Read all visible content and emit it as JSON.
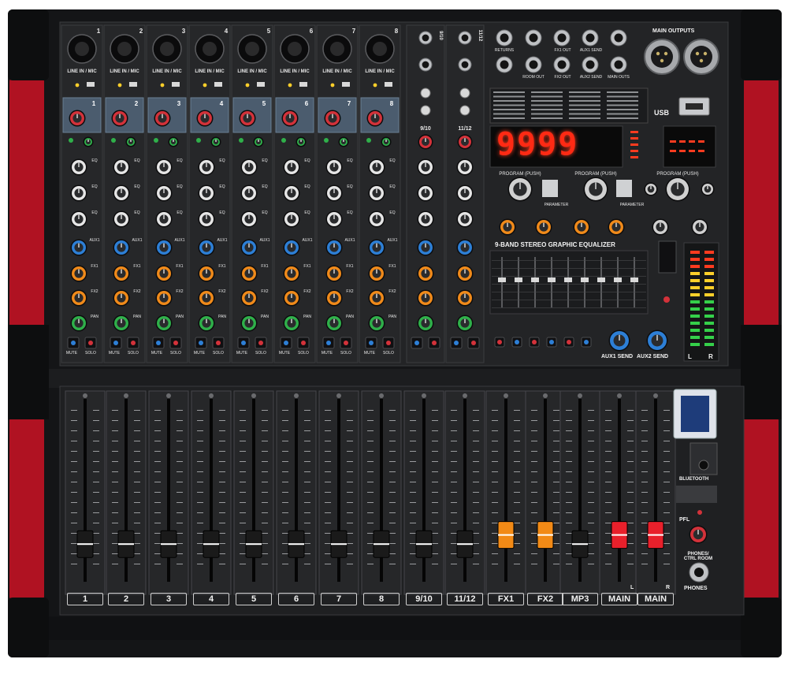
{
  "top_panel": {
    "input_label": "LINE IN / MIC",
    "channel_numbers": [
      "1",
      "2",
      "3",
      "4",
      "5",
      "6",
      "7",
      "8"
    ],
    "stereo_labels": [
      "9/10",
      "11/12"
    ],
    "jack_labels": [
      "FX1 OUT",
      "AUX1 SEND",
      "RETURNS",
      "ROOM OUT",
      "FX2 OUT",
      "AUX2 SEND",
      "MAIN OUTS"
    ],
    "main_outputs_label": "MAIN OUTPUTS",
    "usb_label": "USB",
    "display_value": "9999",
    "program_label": "PROGRAM (PUSH)",
    "parameter_label": "PARAMETER",
    "eq_title": "9-BAND STEREO GRAPHIC EQUALIZER",
    "knob_rows": [
      "EQ",
      "EQ",
      "EQ",
      "AUX1",
      "FX1",
      "FX2",
      "PAN"
    ],
    "mute_label": "MUTE",
    "solo_label": "SOLO",
    "aux1_send_label": "AUX1 SEND",
    "aux2_send_label": "AUX2 SEND",
    "meter_left": "L",
    "meter_right": "R"
  },
  "bottom_panel": {
    "fader_labels": [
      "1",
      "2",
      "3",
      "4",
      "5",
      "6",
      "7",
      "8",
      "9/10",
      "11/12",
      "FX1",
      "FX2",
      "MP3",
      "MAIN",
      "MAIN"
    ],
    "fader_levels": [
      0.15,
      0.15,
      0.15,
      0.15,
      0.15,
      0.15,
      0.15,
      0.15,
      0.15,
      0.15,
      0.2,
      0.2,
      0.15,
      0.2,
      0.2
    ],
    "fader_caps": [
      "black",
      "black",
      "black",
      "black",
      "black",
      "black",
      "black",
      "black",
      "black",
      "black",
      "orange",
      "orange",
      "black",
      "red",
      "red"
    ],
    "bluetooth_label": "BLUETOOTH",
    "pfl_label": "PFL",
    "phones_ctrl_label": "PHONES/ CTRL ROOM",
    "phones_label": "PHONES",
    "main_l": "L",
    "main_r": "R"
  },
  "colors": {
    "chassis": "#151618",
    "panel": "#232426",
    "red_rail": "#b01222",
    "knob_red": "#d3323a",
    "knob_blue": "#2d7fd6",
    "knob_orange": "#f08a1a",
    "knob_green": "#2fb04a",
    "knob_white": "#e6e6e6",
    "display_red": "#ff2a14"
  }
}
